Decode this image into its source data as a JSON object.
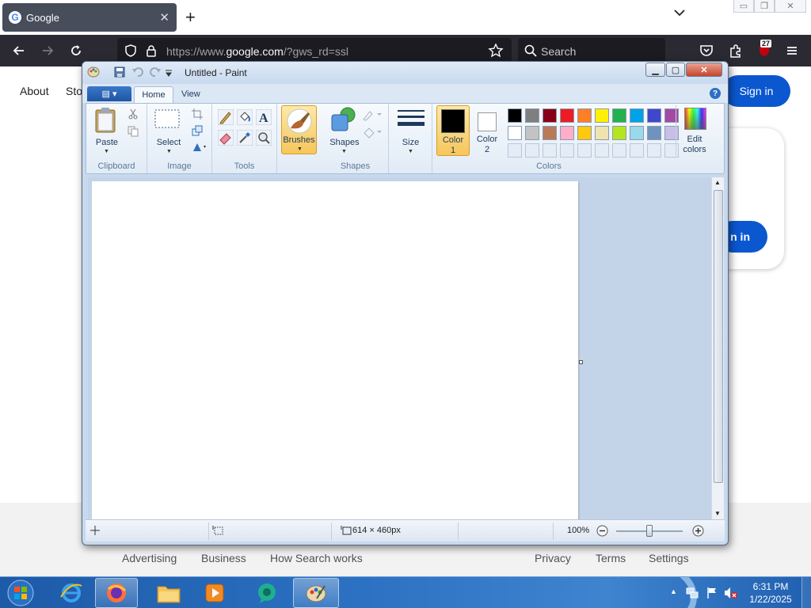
{
  "browser": {
    "tab_title": "Google",
    "tab_close": "✕",
    "new_tab": "+",
    "url_prefix": "https://www.",
    "url_host": "google.com",
    "url_suffix": "/?gws_rd=ssl",
    "search_placeholder": "Search",
    "extensions_badge": "27"
  },
  "google": {
    "nav_about": "About",
    "nav_store": "Sto",
    "signin": "Sign in",
    "card_signin_fragment": "n in",
    "footer_links": [
      "Advertising",
      "Business",
      "How Search works",
      "Privacy",
      "Terms",
      "Settings"
    ]
  },
  "paint": {
    "title": "Untitled - Paint",
    "tabs": {
      "home": "Home",
      "view": "View"
    },
    "help": "?",
    "groups": {
      "clipboard": "Clipboard",
      "image": "Image",
      "tools": "Tools",
      "shapes": "Shapes",
      "colors": "Colors"
    },
    "buttons": {
      "paste": "Paste",
      "select": "Select",
      "brushes": "Brushes",
      "shapes": "Shapes",
      "size": "Size",
      "color1_line1": "Color",
      "color1_line2": "1",
      "color2_line1": "Color",
      "color2_line2": "2",
      "edit_colors_line1": "Edit",
      "edit_colors_line2": "colors"
    },
    "color1": "#000000",
    "color2": "#ffffff",
    "palette_row1": [
      "#000000",
      "#7f7f7f",
      "#880015",
      "#ed1c24",
      "#ff7f27",
      "#fff200",
      "#22b14c",
      "#00a2e8",
      "#3f48cc",
      "#a349a4"
    ],
    "palette_row2": [
      "#ffffff",
      "#c3c3c3",
      "#b97a57",
      "#ffaec9",
      "#ffc90e",
      "#efe4b0",
      "#b5e61d",
      "#99d9ea",
      "#7092be",
      "#c8bfe7"
    ],
    "status": {
      "canvas_size": "614 × 460px",
      "zoom": "100%"
    }
  },
  "taskbar": {
    "time": "6:31 PM",
    "date": "1/22/2025"
  },
  "colors": {
    "google_blue": "#0b57d0",
    "firefox_toolbar": "#2b2a33",
    "paint_accent": "#f6c65a"
  }
}
